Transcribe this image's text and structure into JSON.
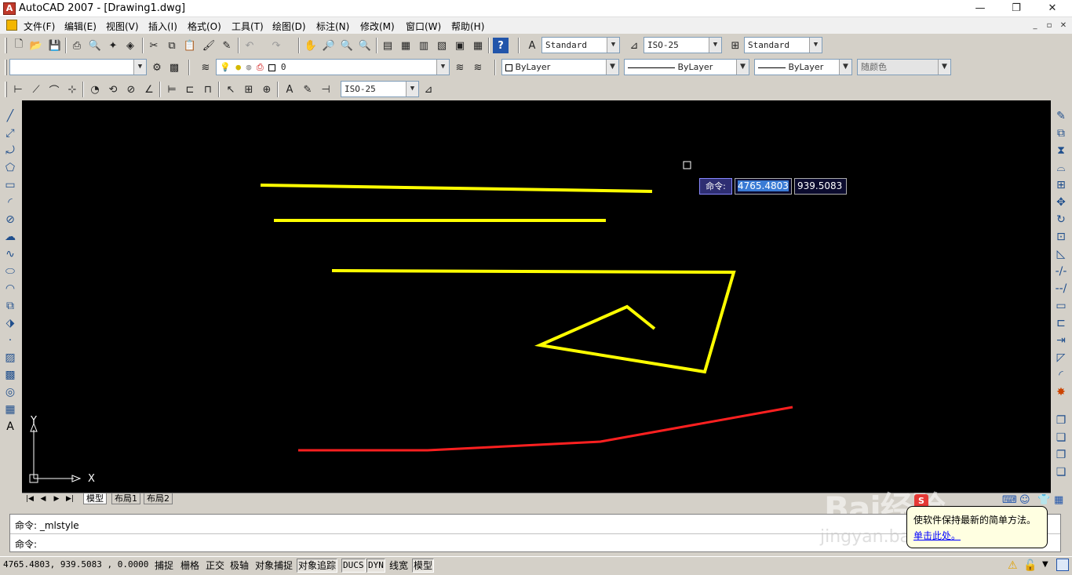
{
  "window": {
    "title": "AutoCAD 2007 - [Drawing1.dwg]",
    "minimize_glyph": "—",
    "maximize_glyph": "❐",
    "close_glyph": "✕",
    "doc_min": "_",
    "doc_restore": "▫",
    "doc_close": "✕"
  },
  "menu": [
    "文件(F)",
    "编辑(E)",
    "视图(V)",
    "插入(I)",
    "格式(O)",
    "工具(T)",
    "绘图(D)",
    "标注(N)",
    "修改(M)",
    "窗口(W)",
    "帮助(H)"
  ],
  "toolbar1": {
    "text_style": "Standard",
    "dim_style": "ISO-25",
    "table_style": "Standard"
  },
  "toolbar2": {
    "workspace": "",
    "layer": "0",
    "color": "ByLayer",
    "linetype": "ByLayer",
    "lineweight": "ByLayer",
    "plotstyle": "随颜色"
  },
  "toolbar3": {
    "dim_style": "ISO-25"
  },
  "icons": {
    "left_tools": [
      "line-icon",
      "construction-line-icon",
      "polyline-icon",
      "polygon-icon",
      "rectangle-icon",
      "arc-icon",
      "circle-icon",
      "revision-cloud-icon",
      "spline-icon",
      "ellipse-icon",
      "ellipse-arc-icon",
      "insert-block-icon",
      "make-block-icon",
      "point-icon",
      "hatch-icon",
      "gradient-icon",
      "region-icon",
      "table-icon",
      "multiline-text-icon"
    ],
    "right_tools": [
      "erase-icon",
      "copy-icon",
      "mirror-icon",
      "offset-icon",
      "array-icon",
      "move-icon",
      "rotate-icon",
      "scale-icon",
      "stretch-icon",
      "trim-icon",
      "extend-icon",
      "break-at-point-icon",
      "break-icon",
      "join-icon",
      "chamfer-icon",
      "fillet-icon",
      "explode-icon"
    ]
  },
  "drawing": {
    "yellow": "#ffff00",
    "red": "#ff2020",
    "axis_y": "Y",
    "axis_x": "X"
  },
  "dynamic_input": {
    "label": "命令:",
    "x": "4765.4803",
    "y": "939.5083"
  },
  "tabs": [
    "模型",
    "布局1",
    "布局2"
  ],
  "command": {
    "history": "命令: _mlstyle",
    "prompt": "命令:"
  },
  "status": {
    "coords": "4765.4803, 939.5083 , 0.0000",
    "buttons": [
      {
        "label": "捕捉",
        "on": false
      },
      {
        "label": "栅格",
        "on": false
      },
      {
        "label": "正交",
        "on": false
      },
      {
        "label": "极轴",
        "on": false
      },
      {
        "label": "对象捕捉",
        "on": false
      },
      {
        "label": "对象追踪",
        "on": true
      },
      {
        "label": "DUCS",
        "on": true
      },
      {
        "label": "DYN",
        "on": true
      },
      {
        "label": "线宽",
        "on": false
      },
      {
        "label": "模型",
        "on": true
      }
    ]
  },
  "notification": {
    "text": "使软件保持最新的简单方法。",
    "link": "单击此处。"
  },
  "watermark": {
    "logo": "Bai经验",
    "url": "jingyan.baidu.com"
  }
}
